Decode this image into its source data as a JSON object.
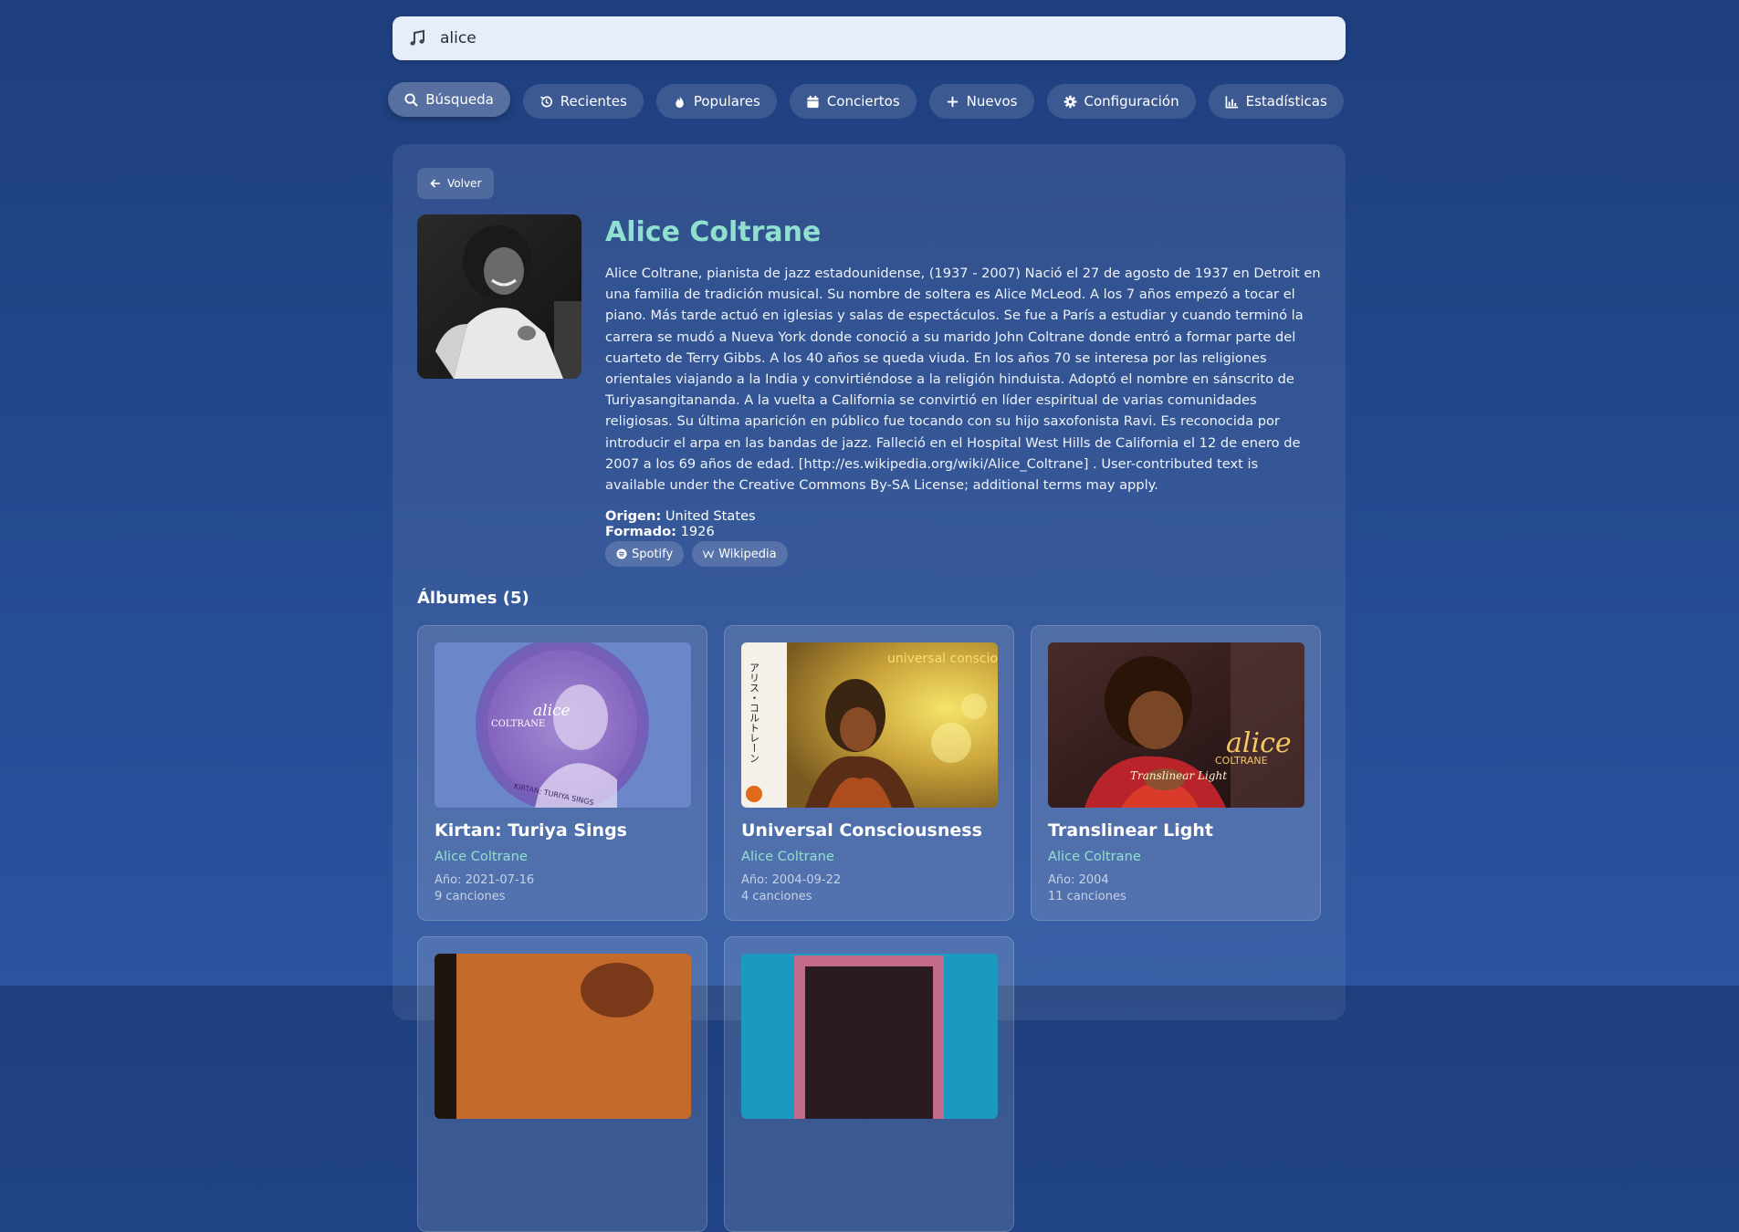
{
  "search": {
    "value": "alice",
    "icon": "music-note-icon"
  },
  "nav": [
    {
      "label": "Búsqueda",
      "icon": "search-icon",
      "active": true
    },
    {
      "label": "Recientes",
      "icon": "history-icon"
    },
    {
      "label": "Populares",
      "icon": "fire-icon"
    },
    {
      "label": "Conciertos",
      "icon": "calendar-icon"
    },
    {
      "label": "Nuevos",
      "icon": "plus-icon"
    },
    {
      "label": "Configuración",
      "icon": "gear-icon"
    },
    {
      "label": "Estadísticas",
      "icon": "chart-icon"
    }
  ],
  "back_label": "Volver",
  "artist": {
    "name": "Alice Coltrane",
    "bio": "Alice Coltrane, pianista de jazz estadounidense, (1937 - 2007) Nació el 27 de agosto de 1937 en Detroit en una familia de tradición musical. Su nombre de soltera es Alice McLeod. A los 7 años empezó a tocar el piano. Más tarde actuó en iglesias y salas de espectáculos. Se fue a París a estudiar y cuando terminó la carrera se mudó a Nueva York donde conoció a su marido John Coltrane donde entró a formar parte del cuarteto de Terry Gibbs. A los 40 años se queda viuda. En los años 70 se interesa por las religiones orientales viajando a la India y convirtiéndose a la religión hinduista. Adoptó el nombre en sánscrito de Turiyasangitananda. A la vuelta a California se convirtió en líder espiritual de varias comunidades religiosas. Su última aparición en público fue tocando con su hijo saxofonista Ravi. Es reconocida por introducir el arpa en las bandas de jazz. Falleció en el Hospital West Hills de California el 12 de enero de 2007 a los 69 años de edad. [http://es.wikipedia.org/wiki/Alice_Coltrane] . User-contributed text is available under the Creative Commons By-SA License; additional terms may apply.",
    "origin_label": "Origen:",
    "origin": "United States",
    "formed_label": "Formado:",
    "formed": "1926",
    "links": [
      {
        "label": "Spotify",
        "icon": "spotify-icon"
      },
      {
        "label": "Wikipedia",
        "icon": "wikipedia-icon"
      }
    ]
  },
  "albums_title": "Álbumes (5)",
  "albums": [
    {
      "title": "Kirtan: Turiya Sings",
      "artist": "Alice Coltrane",
      "year": "Año: 2021-07-16",
      "tracks": "9 canciones",
      "cover_text": "alice",
      "cover_sub": "COLTRANE",
      "cover_caption": "KIRTAN: TURIYA SINGS"
    },
    {
      "title": "Universal Consciousness",
      "artist": "Alice Coltrane",
      "year": "Año: 2004-09-22",
      "tracks": "4 canciones",
      "cover_text": "universal consciousness",
      "cover_jp": "アリス・コルトレーン"
    },
    {
      "title": "Translinear Light",
      "artist": "Alice Coltrane",
      "year": "Año: 2004",
      "tracks": "11 canciones",
      "cover_text": "alice",
      "cover_sub": "COLTRANE",
      "cover_caption": "Translinear Light"
    }
  ]
}
